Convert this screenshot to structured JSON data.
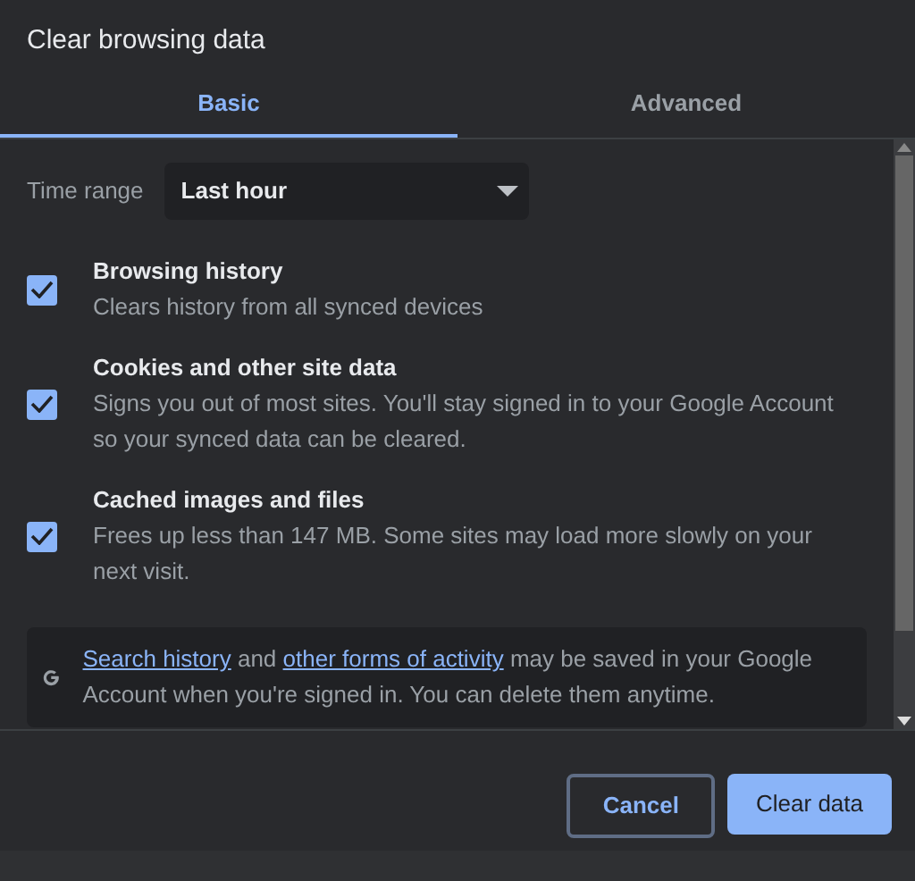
{
  "dialog": {
    "title": "Clear browsing data"
  },
  "tabs": [
    {
      "label": "Basic",
      "selected": true
    },
    {
      "label": "Advanced",
      "selected": false
    }
  ],
  "time_range": {
    "label": "Time range",
    "value": "Last hour"
  },
  "options": [
    {
      "title": "Browsing history",
      "description": "Clears history from all synced devices",
      "checked": true
    },
    {
      "title": "Cookies and other site data",
      "description": "Signs you out of most sites. You'll stay signed in to your Google Account so your synced data can be cleared.",
      "checked": true
    },
    {
      "title": "Cached images and files",
      "description": "Frees up less than 147 MB. Some sites may load more slowly on your next visit.",
      "checked": true
    }
  ],
  "info": {
    "segments": [
      {
        "kind": "link",
        "text": "Search history"
      },
      {
        "kind": "text",
        "text": " and "
      },
      {
        "kind": "link",
        "text": "other forms of activity"
      },
      {
        "kind": "text",
        "text": " may be saved in your Google Account when you're signed in. You can delete them anytime."
      }
    ]
  },
  "buttons": [
    {
      "label": "Cancel",
      "kind": "secondary"
    },
    {
      "label": "Clear data",
      "kind": "primary"
    }
  ]
}
